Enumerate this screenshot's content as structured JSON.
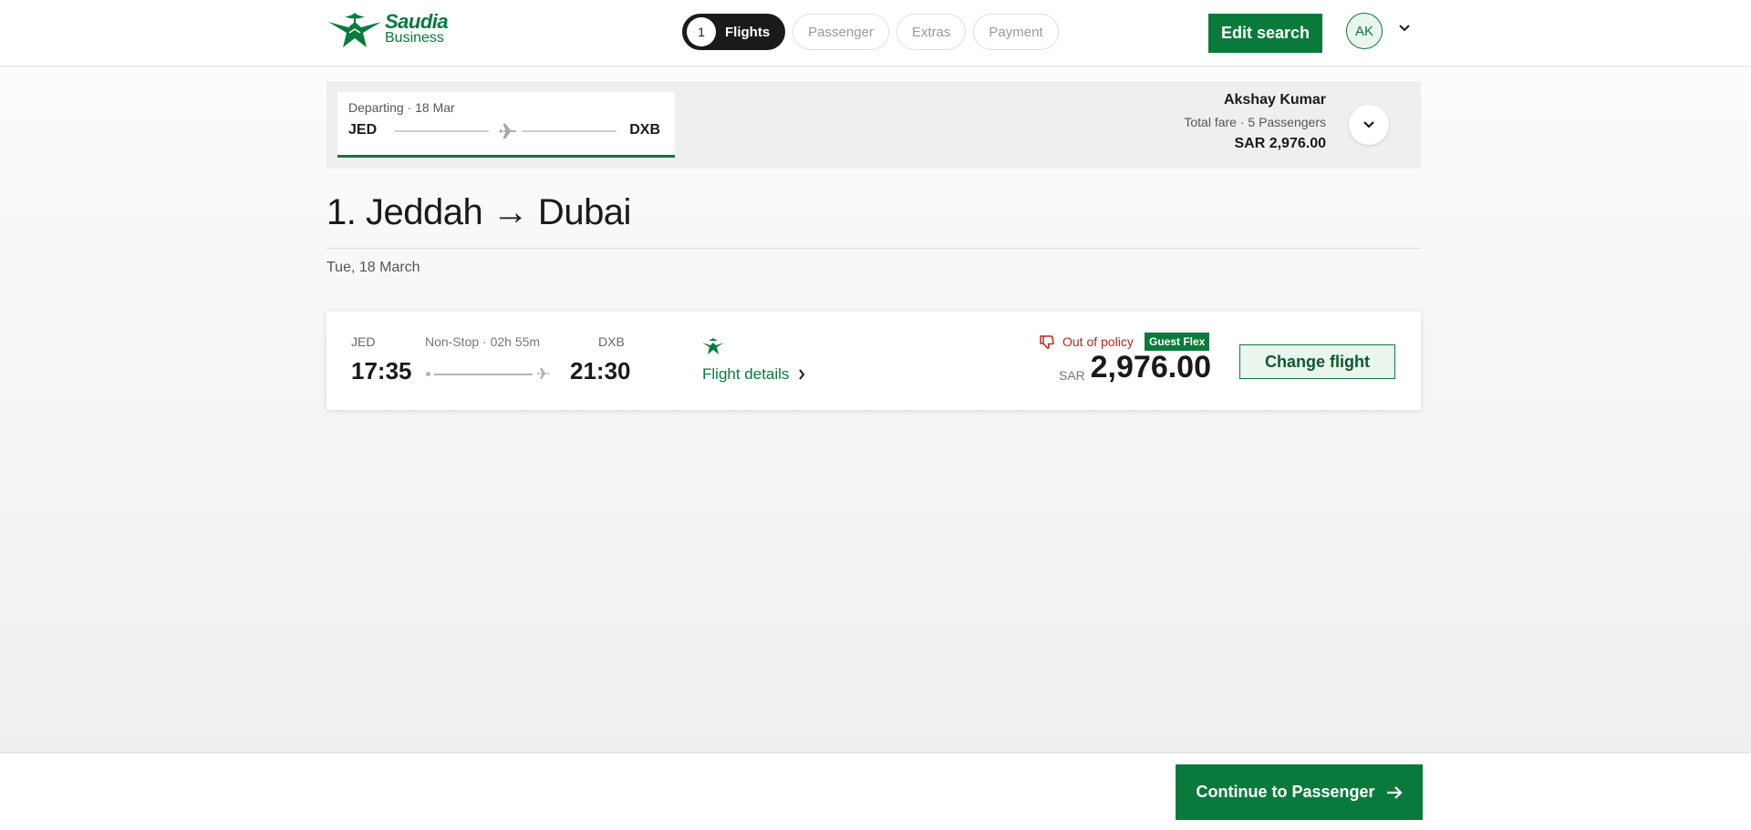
{
  "brand": {
    "name_line1": "Saudia",
    "name_line2": "Business",
    "color": "#0a7a3c"
  },
  "steps": [
    {
      "number": "1",
      "label": "Flights",
      "active": true
    },
    {
      "label": "Passenger",
      "active": false
    },
    {
      "label": "Extras",
      "active": false
    },
    {
      "label": "Payment",
      "active": false
    }
  ],
  "header": {
    "edit_search_label": "Edit search",
    "avatar_initials": "AK",
    "menu_icon": "chevron-down-icon"
  },
  "summary": {
    "segment_label": "Departing · 18 Mar",
    "from": "JED",
    "to": "DXB",
    "passenger_name": "Akshay Kumar",
    "fare_label": "Total fare · 5 Passengers",
    "total_fare": "SAR 2,976.00",
    "expand_icon": "chevron-down-icon"
  },
  "journey": {
    "title": "1. Jeddah → Dubai",
    "date": "Tue, 18 March"
  },
  "flight": {
    "dep_code": "JED",
    "dep_time": "17:35",
    "duration": "Non-Stop · 02h 55m",
    "arr_code": "DXB",
    "arr_time": "21:30",
    "details_label": "Flight details",
    "policy_label": "Out of policy",
    "policy_color": "#c0221c",
    "fare_class": "Guest Flex",
    "currency": "SAR",
    "price": "2,976.00",
    "change_label": "Change flight"
  },
  "footer": {
    "continue_label": "Continue to Passenger"
  }
}
